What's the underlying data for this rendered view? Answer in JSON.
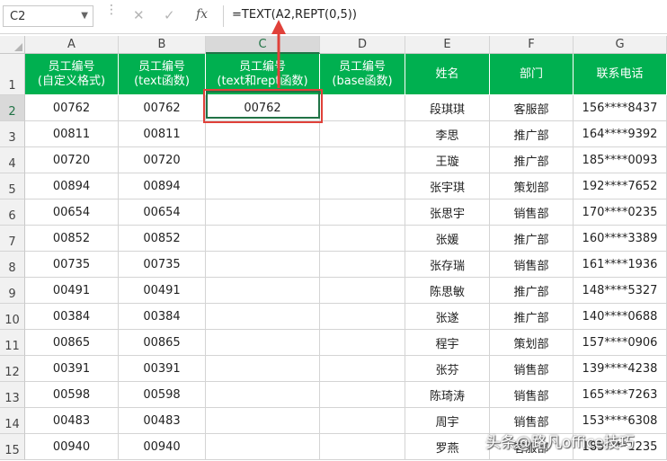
{
  "formula_bar": {
    "name_box": "C2",
    "formula": "=TEXT(A2,REPT(0,5))",
    "icons": [
      "cancel-icon",
      "confirm-icon",
      "insert-function-icon"
    ],
    "fx_label": "fx"
  },
  "sheet": {
    "columns": [
      "A",
      "B",
      "C",
      "D",
      "E",
      "F",
      "G"
    ],
    "selected_column": "C",
    "selected_row": "2",
    "header_fill": "#00b050",
    "header_row": [
      [
        "员工编号",
        "(自定义格式)"
      ],
      [
        "员工编号",
        "(text函数)"
      ],
      [
        "员工编号",
        "(text和rept函数)"
      ],
      [
        "员工编号",
        "(base函数)"
      ],
      [
        "姓名"
      ],
      [
        "部门"
      ],
      [
        "联系电话"
      ]
    ],
    "rows": [
      {
        "n": "2",
        "a": "00762",
        "b": "00762",
        "c": "00762",
        "d": "",
        "e": "段琪琪",
        "f": "客服部",
        "g": "156****8437"
      },
      {
        "n": "3",
        "a": "00811",
        "b": "00811",
        "c": "",
        "d": "",
        "e": "李思",
        "f": "推广部",
        "g": "164****9392"
      },
      {
        "n": "4",
        "a": "00720",
        "b": "00720",
        "c": "",
        "d": "",
        "e": "王璇",
        "f": "推广部",
        "g": "185****0093"
      },
      {
        "n": "5",
        "a": "00894",
        "b": "00894",
        "c": "",
        "d": "",
        "e": "张宇琪",
        "f": "策划部",
        "g": "192****7652"
      },
      {
        "n": "6",
        "a": "00654",
        "b": "00654",
        "c": "",
        "d": "",
        "e": "张思宇",
        "f": "销售部",
        "g": "170****0235"
      },
      {
        "n": "7",
        "a": "00852",
        "b": "00852",
        "c": "",
        "d": "",
        "e": "张媛",
        "f": "推广部",
        "g": "160****3389"
      },
      {
        "n": "8",
        "a": "00735",
        "b": "00735",
        "c": "",
        "d": "",
        "e": "张存瑞",
        "f": "销售部",
        "g": "161****1936"
      },
      {
        "n": "9",
        "a": "00491",
        "b": "00491",
        "c": "",
        "d": "",
        "e": "陈思敏",
        "f": "推广部",
        "g": "148****5327"
      },
      {
        "n": "10",
        "a": "00384",
        "b": "00384",
        "c": "",
        "d": "",
        "e": "张遂",
        "f": "推广部",
        "g": "140****0688"
      },
      {
        "n": "11",
        "a": "00865",
        "b": "00865",
        "c": "",
        "d": "",
        "e": "程宇",
        "f": "策划部",
        "g": "157****0906"
      },
      {
        "n": "12",
        "a": "00391",
        "b": "00391",
        "c": "",
        "d": "",
        "e": "张芬",
        "f": "销售部",
        "g": "139****4238"
      },
      {
        "n": "13",
        "a": "00598",
        "b": "00598",
        "c": "",
        "d": "",
        "e": "陈琦涛",
        "f": "销售部",
        "g": "165****7263"
      },
      {
        "n": "14",
        "a": "00483",
        "b": "00483",
        "c": "",
        "d": "",
        "e": "周宇",
        "f": "销售部",
        "g": "153****6308"
      },
      {
        "n": "15",
        "a": "00940",
        "b": "00940",
        "c": "",
        "d": "",
        "e": "罗燕",
        "f": "客服部",
        "g": "185****1235"
      }
    ]
  },
  "annotation_color": "#e0413a",
  "watermark": "头条@路凡office技巧"
}
